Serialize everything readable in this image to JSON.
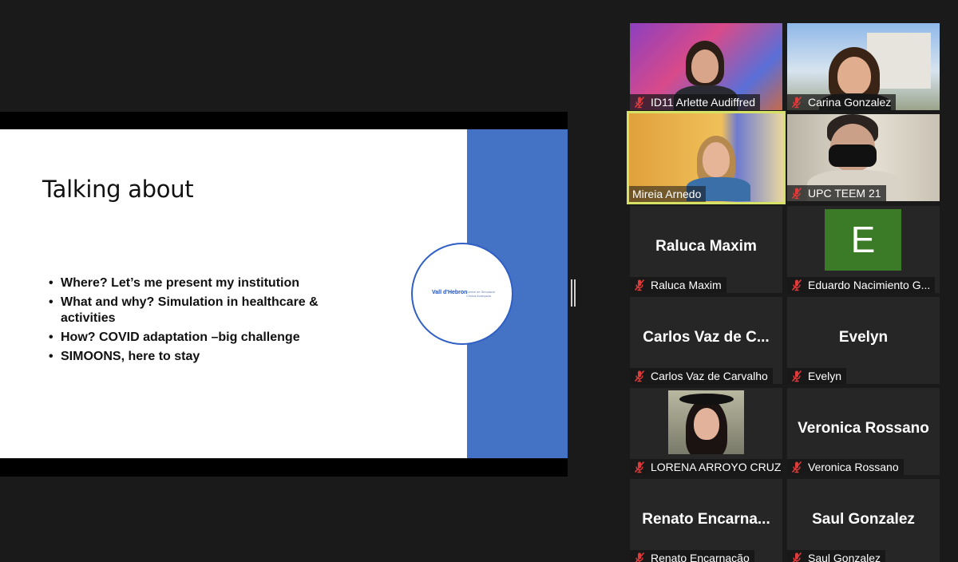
{
  "slide": {
    "title": "Talking about",
    "bullets": [
      "Where? Let’s me present my institution",
      "What and why?  Simulation in healthcare & activities",
      "How? COVID adaptation –big challenge",
      "SIMOONS, here to stay"
    ],
    "logo_name": "Vall d'Hebron",
    "logo_subtitle": "Centre de Simulació Clínica Avançada",
    "band_color": "#4472c4"
  },
  "gallery": {
    "active_speaker_color": "#d5e265",
    "muted_icon": "mic-muted-icon",
    "participants": [
      {
        "label": "ID11 Arlette Audiffred",
        "muted": true,
        "kind": "video"
      },
      {
        "label": "Carina Gonzalez",
        "muted": true,
        "kind": "video"
      },
      {
        "label": "Mireia Arnedo",
        "muted": false,
        "kind": "video",
        "active": true
      },
      {
        "label": "UPC TEEM 21",
        "muted": true,
        "kind": "video"
      },
      {
        "label": "Raluca Maxim",
        "display": "Raluca Maxim",
        "muted": true,
        "kind": "name"
      },
      {
        "label": "Eduardo Nacimiento G...",
        "avatar_letter": "E",
        "muted": true,
        "kind": "avatar"
      },
      {
        "label": "Carlos Vaz de Carvalho",
        "display": "Carlos  Vaz  de  C...",
        "muted": true,
        "kind": "name"
      },
      {
        "label": "Evelyn",
        "display": "Evelyn",
        "muted": true,
        "kind": "name"
      },
      {
        "label": "LORENA ARROYO CRUZ",
        "muted": true,
        "kind": "photo"
      },
      {
        "label": "Veronica Rossano",
        "display": "Veronica Rossano",
        "muted": true,
        "kind": "name"
      },
      {
        "label": "Renato Encarnação",
        "display": "Renato  Encarna...",
        "muted": true,
        "kind": "name"
      },
      {
        "label": "Saul Gonzalez",
        "display": "Saul Gonzalez",
        "muted": true,
        "kind": "name"
      }
    ]
  }
}
